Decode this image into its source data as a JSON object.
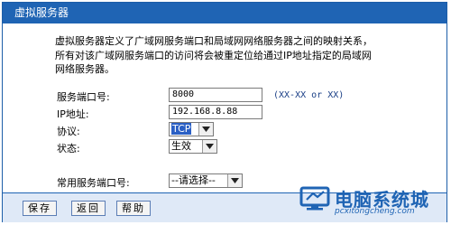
{
  "window": {
    "title": "虚拟服务器"
  },
  "description": {
    "line1": "虚拟服务器定义了广域网服务端口和局域网网络服务器之间的映射关系，",
    "line2": "所有对该广域网服务端口的访问将会被重定位给通过IP地址指定的局域网",
    "line3": "网络服务器。"
  },
  "form": {
    "service_port": {
      "label": "服务端口号:",
      "value": "8000",
      "hint": "(XX-XX or XX)"
    },
    "ip_address": {
      "label": "IP地址:",
      "value": "192.168.8.88"
    },
    "protocol": {
      "label": "协议:",
      "value": "TCP"
    },
    "status": {
      "label": "状态:",
      "value": "生效"
    },
    "common_port": {
      "label": "常用服务端口号:",
      "value": "--请选择--"
    }
  },
  "buttons": {
    "save": "保存",
    "back": "返回",
    "help": "帮助"
  },
  "watermark": {
    "text": "电脑系统城",
    "url": "pcxitongcheng.com"
  },
  "colors": {
    "accent": "#1f64b4",
    "footer_bg": "#dfe9f7"
  }
}
